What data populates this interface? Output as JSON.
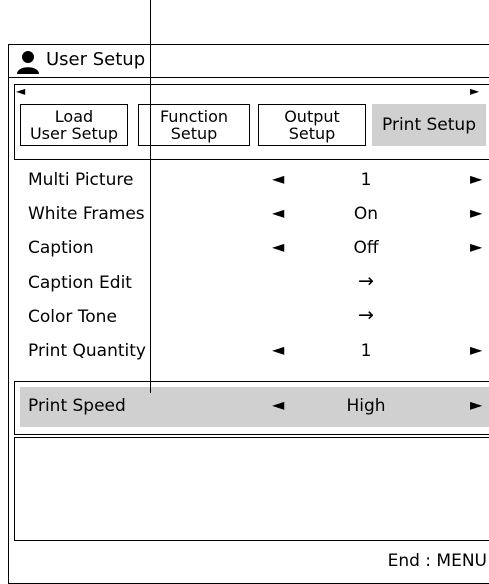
{
  "window": {
    "title": "User Setup",
    "icon": "user-icon"
  },
  "tabs": [
    {
      "line1": "Load",
      "line2": "User Setup"
    },
    {
      "line1": "Function",
      "line2": "Setup"
    },
    {
      "line1": "Output",
      "line2": "Setup"
    },
    {
      "line1": "Print Setup",
      "line2": "",
      "active": true
    }
  ],
  "scroll": {
    "left": "◄",
    "right": "►"
  },
  "rows": [
    {
      "label": "Multi Picture",
      "value": "1",
      "kind": "select",
      "left_arrow": "◄",
      "right_arrow": "►"
    },
    {
      "label": "White Frames",
      "value": "On",
      "kind": "select",
      "left_arrow": "◄",
      "right_arrow": "►"
    },
    {
      "label": "Caption",
      "value": "Off",
      "kind": "select",
      "left_arrow": "◄",
      "right_arrow": "►"
    },
    {
      "label": "Caption Edit",
      "value": "→",
      "kind": "go"
    },
    {
      "label": "Color Tone",
      "value": "→",
      "kind": "go"
    },
    {
      "label": "Print Quantity",
      "value": "1",
      "kind": "select",
      "left_arrow": "◄",
      "right_arrow": "►"
    },
    {
      "label": "Print Speed",
      "value": "High",
      "kind": "select",
      "left_arrow": "◄",
      "right_arrow": "►",
      "selected": true
    }
  ],
  "footer": {
    "hint": "End : MENU"
  },
  "colors": {
    "selection": "#d0d0d0",
    "border": "#000000",
    "background": "#ffffff"
  }
}
